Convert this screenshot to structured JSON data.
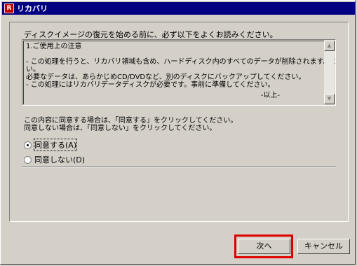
{
  "window": {
    "title": "リカバリ",
    "app_icon": "recovery-app-icon",
    "accent_color": "#000080"
  },
  "main": {
    "instruction": "ディスクイメージの復元を始める前に、必ず以下をよくお読みください。",
    "notes": {
      "lines": [
        "1.ご使用上の注意",
        "",
        " - この処理を行うと、リカバリ領域も含め、ハードディスク内のすべてのデータが削除されます。ご注意くださ",
        "い。",
        "   必要なデータは、あらかじめCD/DVDなど、別のディスクにバックアップしてください。",
        " - この処理にはリカバリデータディスクが必要です。事前に準備してください。"
      ],
      "end_mark": "-以上-"
    },
    "consent_text": [
      "この内容に同意する場合は、「同意する」をクリックしてください。",
      "同意しない場合は、「同意しない」をクリックしてください。"
    ],
    "options": [
      {
        "label": "同意する(A)",
        "selected": true
      },
      {
        "label": "同意しない(D)",
        "selected": false
      }
    ]
  },
  "footer": {
    "next_label": "次へ",
    "cancel_label": "キャンセル",
    "highlight_color": "#e00000"
  }
}
